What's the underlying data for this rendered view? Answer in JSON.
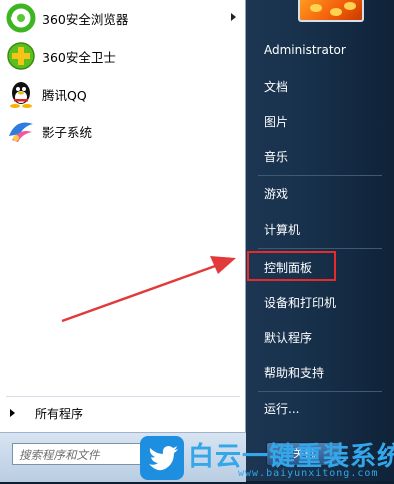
{
  "left_pane": {
    "programs": [
      {
        "label": "360安全浏览器",
        "icon": "browser-360-icon",
        "has_submenu": true
      },
      {
        "label": "360安全卫士",
        "icon": "guard-360-icon",
        "has_submenu": false
      },
      {
        "label": "腾讯QQ",
        "icon": "qq-penguin-icon",
        "has_submenu": false
      },
      {
        "label": "影子系统",
        "icon": "shadow-system-icon",
        "has_submenu": false
      }
    ],
    "all_programs": "所有程序",
    "search_placeholder": "搜索程序和文件"
  },
  "right_pane": {
    "items": [
      "Administrator",
      "文档",
      "图片",
      "音乐",
      "游戏",
      "计算机",
      "控制面板",
      "设备和打印机",
      "默认程序",
      "帮助和支持",
      "运行..."
    ],
    "highlighted_item": "控制面板",
    "shutdown_label": "关机"
  },
  "watermark": {
    "brand": "白云一键重装系统",
    "site": "www.baiyunxitong.com"
  },
  "colors": {
    "right_pane_bg": "#17304a",
    "highlight_border": "#e82a2a",
    "watermark_blue": "#34a6ea"
  }
}
